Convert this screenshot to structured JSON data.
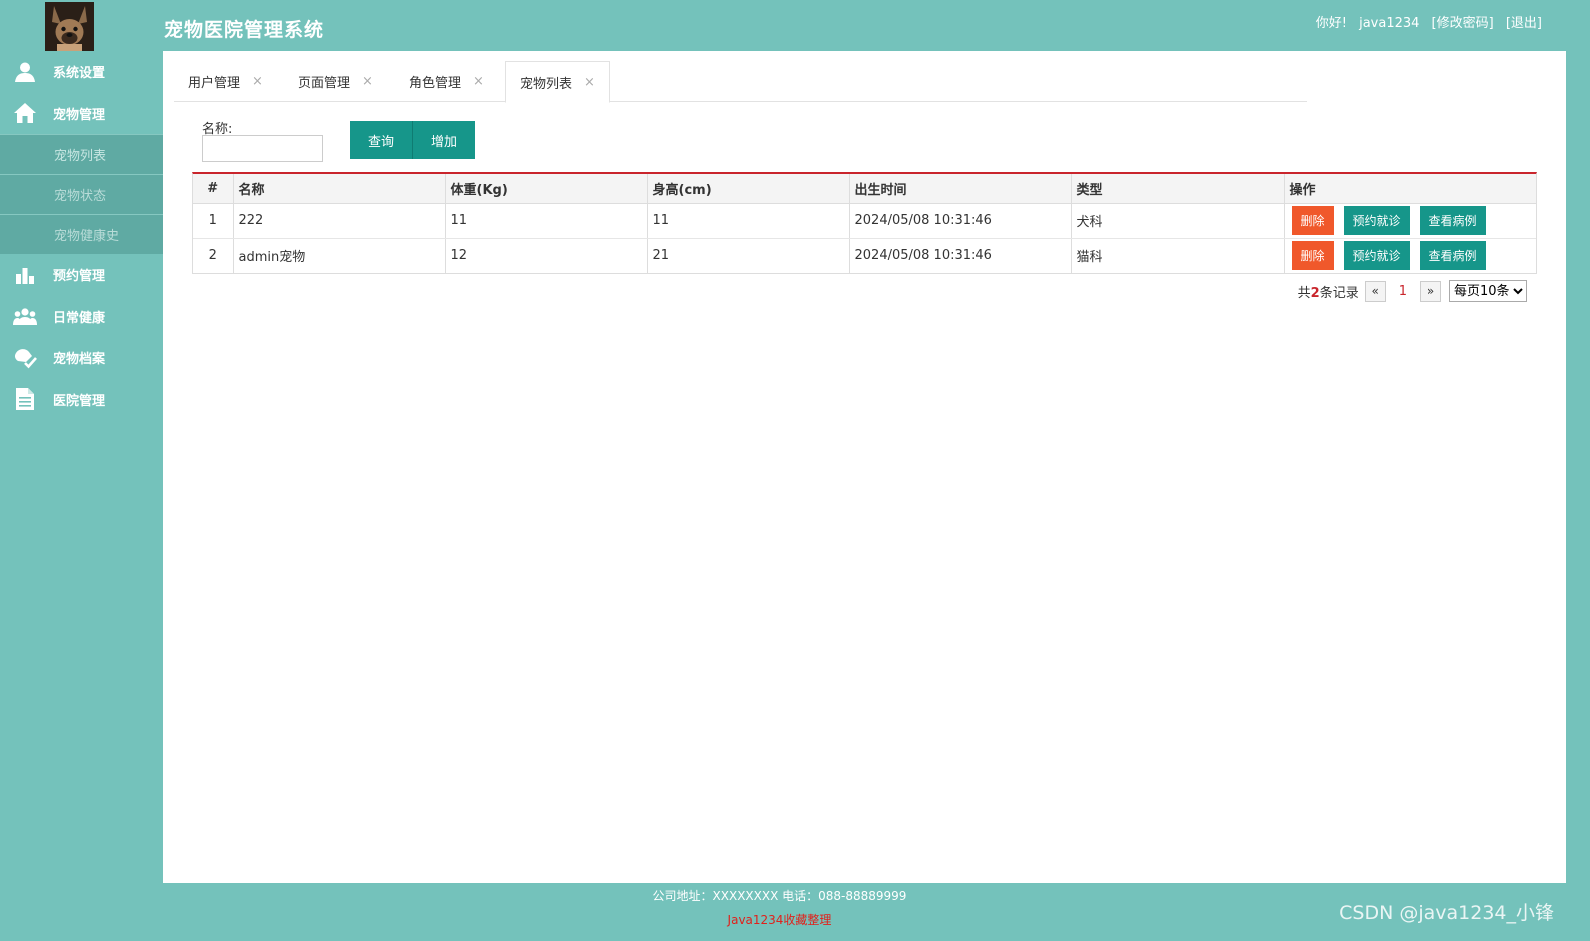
{
  "header": {
    "title": "宠物医院管理系统",
    "greeting": "你好!",
    "username": "java1234",
    "change_password": "[修改密码]",
    "logout": "[退出]"
  },
  "sidebar": {
    "items": [
      {
        "label": "系统设置",
        "icon": "user-icon"
      },
      {
        "label": "宠物管理",
        "icon": "home-icon"
      },
      {
        "label": "预约管理",
        "icon": "bar-chart-icon"
      },
      {
        "label": "日常健康",
        "icon": "users-icon"
      },
      {
        "label": "宠物档案",
        "icon": "paw-check-icon"
      },
      {
        "label": "医院管理",
        "icon": "document-icon"
      }
    ],
    "sub_items": [
      "宠物列表",
      "宠物状态",
      "宠物健康史"
    ]
  },
  "tabs": [
    {
      "label": "用户管理",
      "close": "×"
    },
    {
      "label": "页面管理",
      "close": "×"
    },
    {
      "label": "角色管理",
      "close": "×"
    },
    {
      "label": "宠物列表",
      "close": "×"
    }
  ],
  "filter": {
    "label": "名称:",
    "value": "",
    "query_button": "查询",
    "add_button": "增加"
  },
  "table": {
    "headers": [
      "#",
      "名称",
      "体重(Kg)",
      "身高(cm)",
      "出生时间",
      "类型",
      "操作"
    ],
    "rows": [
      {
        "index": "1",
        "name": "222",
        "weight": "11",
        "height": "11",
        "birth": "2024/05/08 10:31:46",
        "type": "犬科"
      },
      {
        "index": "2",
        "name": "admin宠物",
        "weight": "12",
        "height": "21",
        "birth": "2024/05/08 10:31:46",
        "type": "猫科"
      }
    ],
    "actions": {
      "delete": "删除",
      "appointment": "预约就诊",
      "records": "查看病例"
    }
  },
  "pager": {
    "prefix": "共",
    "count": "2",
    "suffix": "条记录",
    "prev": "«",
    "page": "1",
    "next": "»",
    "page_size": "每页10条"
  },
  "footer": {
    "address": "公司地址：XXXXXXXX 电话：088-88889999",
    "credit": "Java1234收藏整理"
  },
  "watermark": "CSDN @java1234_小锋",
  "colors": {
    "teal_bg": "#74c2bb",
    "button_teal": "#16968a",
    "delete_orange": "#f0582b",
    "accent_red": "#c9252c"
  }
}
